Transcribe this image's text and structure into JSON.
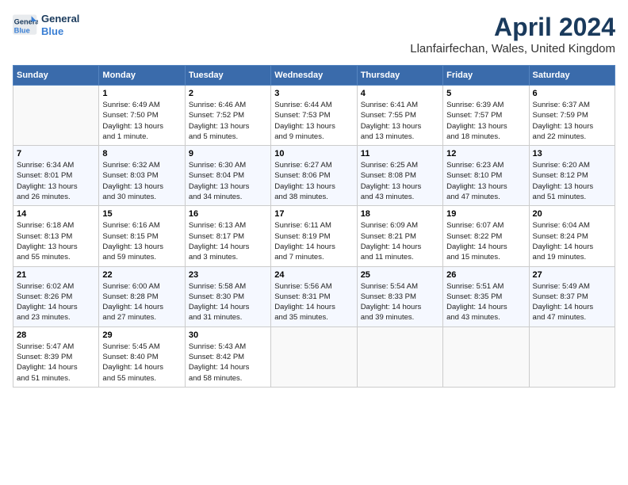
{
  "header": {
    "logo_line1": "General",
    "logo_line2": "Blue",
    "month": "April 2024",
    "location": "Llanfairfechan, Wales, United Kingdom"
  },
  "days_of_week": [
    "Sunday",
    "Monday",
    "Tuesday",
    "Wednesday",
    "Thursday",
    "Friday",
    "Saturday"
  ],
  "weeks": [
    [
      {
        "day": "",
        "info": ""
      },
      {
        "day": "1",
        "info": "Sunrise: 6:49 AM\nSunset: 7:50 PM\nDaylight: 13 hours\nand 1 minute."
      },
      {
        "day": "2",
        "info": "Sunrise: 6:46 AM\nSunset: 7:52 PM\nDaylight: 13 hours\nand 5 minutes."
      },
      {
        "day": "3",
        "info": "Sunrise: 6:44 AM\nSunset: 7:53 PM\nDaylight: 13 hours\nand 9 minutes."
      },
      {
        "day": "4",
        "info": "Sunrise: 6:41 AM\nSunset: 7:55 PM\nDaylight: 13 hours\nand 13 minutes."
      },
      {
        "day": "5",
        "info": "Sunrise: 6:39 AM\nSunset: 7:57 PM\nDaylight: 13 hours\nand 18 minutes."
      },
      {
        "day": "6",
        "info": "Sunrise: 6:37 AM\nSunset: 7:59 PM\nDaylight: 13 hours\nand 22 minutes."
      }
    ],
    [
      {
        "day": "7",
        "info": "Sunrise: 6:34 AM\nSunset: 8:01 PM\nDaylight: 13 hours\nand 26 minutes."
      },
      {
        "day": "8",
        "info": "Sunrise: 6:32 AM\nSunset: 8:03 PM\nDaylight: 13 hours\nand 30 minutes."
      },
      {
        "day": "9",
        "info": "Sunrise: 6:30 AM\nSunset: 8:04 PM\nDaylight: 13 hours\nand 34 minutes."
      },
      {
        "day": "10",
        "info": "Sunrise: 6:27 AM\nSunset: 8:06 PM\nDaylight: 13 hours\nand 38 minutes."
      },
      {
        "day": "11",
        "info": "Sunrise: 6:25 AM\nSunset: 8:08 PM\nDaylight: 13 hours\nand 43 minutes."
      },
      {
        "day": "12",
        "info": "Sunrise: 6:23 AM\nSunset: 8:10 PM\nDaylight: 13 hours\nand 47 minutes."
      },
      {
        "day": "13",
        "info": "Sunrise: 6:20 AM\nSunset: 8:12 PM\nDaylight: 13 hours\nand 51 minutes."
      }
    ],
    [
      {
        "day": "14",
        "info": "Sunrise: 6:18 AM\nSunset: 8:13 PM\nDaylight: 13 hours\nand 55 minutes."
      },
      {
        "day": "15",
        "info": "Sunrise: 6:16 AM\nSunset: 8:15 PM\nDaylight: 13 hours\nand 59 minutes."
      },
      {
        "day": "16",
        "info": "Sunrise: 6:13 AM\nSunset: 8:17 PM\nDaylight: 14 hours\nand 3 minutes."
      },
      {
        "day": "17",
        "info": "Sunrise: 6:11 AM\nSunset: 8:19 PM\nDaylight: 14 hours\nand 7 minutes."
      },
      {
        "day": "18",
        "info": "Sunrise: 6:09 AM\nSunset: 8:21 PM\nDaylight: 14 hours\nand 11 minutes."
      },
      {
        "day": "19",
        "info": "Sunrise: 6:07 AM\nSunset: 8:22 PM\nDaylight: 14 hours\nand 15 minutes."
      },
      {
        "day": "20",
        "info": "Sunrise: 6:04 AM\nSunset: 8:24 PM\nDaylight: 14 hours\nand 19 minutes."
      }
    ],
    [
      {
        "day": "21",
        "info": "Sunrise: 6:02 AM\nSunset: 8:26 PM\nDaylight: 14 hours\nand 23 minutes."
      },
      {
        "day": "22",
        "info": "Sunrise: 6:00 AM\nSunset: 8:28 PM\nDaylight: 14 hours\nand 27 minutes."
      },
      {
        "day": "23",
        "info": "Sunrise: 5:58 AM\nSunset: 8:30 PM\nDaylight: 14 hours\nand 31 minutes."
      },
      {
        "day": "24",
        "info": "Sunrise: 5:56 AM\nSunset: 8:31 PM\nDaylight: 14 hours\nand 35 minutes."
      },
      {
        "day": "25",
        "info": "Sunrise: 5:54 AM\nSunset: 8:33 PM\nDaylight: 14 hours\nand 39 minutes."
      },
      {
        "day": "26",
        "info": "Sunrise: 5:51 AM\nSunset: 8:35 PM\nDaylight: 14 hours\nand 43 minutes."
      },
      {
        "day": "27",
        "info": "Sunrise: 5:49 AM\nSunset: 8:37 PM\nDaylight: 14 hours\nand 47 minutes."
      }
    ],
    [
      {
        "day": "28",
        "info": "Sunrise: 5:47 AM\nSunset: 8:39 PM\nDaylight: 14 hours\nand 51 minutes."
      },
      {
        "day": "29",
        "info": "Sunrise: 5:45 AM\nSunset: 8:40 PM\nDaylight: 14 hours\nand 55 minutes."
      },
      {
        "day": "30",
        "info": "Sunrise: 5:43 AM\nSunset: 8:42 PM\nDaylight: 14 hours\nand 58 minutes."
      },
      {
        "day": "",
        "info": ""
      },
      {
        "day": "",
        "info": ""
      },
      {
        "day": "",
        "info": ""
      },
      {
        "day": "",
        "info": ""
      }
    ]
  ]
}
